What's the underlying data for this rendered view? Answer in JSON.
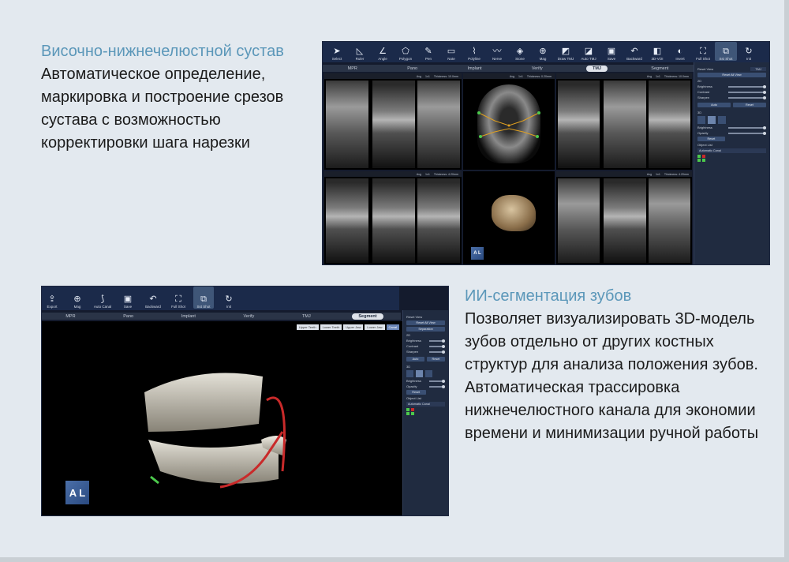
{
  "section1": {
    "title": "Височно-нижнечелюстной сустав",
    "description": "Автоматическое определение, маркировка и построение срезов сустава с возможностью корректировки шага нарезки",
    "toolbar": [
      {
        "label": "Select",
        "icon": "cursor-icon"
      },
      {
        "label": "Ruler",
        "icon": "ruler-icon"
      },
      {
        "label": "Angle",
        "icon": "angle-icon"
      },
      {
        "label": "Polygon",
        "icon": "polygon-icon"
      },
      {
        "label": "Pen",
        "icon": "pen-icon"
      },
      {
        "label": "Note",
        "icon": "note-icon"
      },
      {
        "label": "Polyline",
        "icon": "polyline-icon"
      },
      {
        "label": "Nerve",
        "icon": "nerve-icon"
      },
      {
        "label": "Stone",
        "icon": "stone-icon"
      },
      {
        "label": "Mag",
        "icon": "magnifier-icon"
      },
      {
        "label": "Draw TMJ",
        "icon": "draw-tmj-icon"
      },
      {
        "label": "Auto TMJ",
        "icon": "auto-tmj-icon"
      },
      {
        "label": "Save",
        "icon": "save-icon"
      },
      {
        "label": "Backward",
        "icon": "backward-icon"
      },
      {
        "label": "3D-VOI",
        "icon": "voi-icon"
      },
      {
        "label": "Invert",
        "icon": "invert-icon"
      },
      {
        "label": "Full Shot",
        "icon": "full-shot-icon"
      },
      {
        "label": "Sst Shot",
        "icon": "shot-icon"
      },
      {
        "label": "Init",
        "icon": "init-icon"
      }
    ],
    "tabs": [
      "MPR",
      "Pano",
      "Implant",
      "Verify",
      "TMJ",
      "Segment"
    ],
    "active_tab": "TMJ",
    "view_strip": {
      "mode": "Avg",
      "scale": "1x1",
      "thickness_a": "Thickness: 10.0mm",
      "thickness_b": "Thickness: 0.20mm",
      "thickness_c": "Thickness: 4.20mm"
    },
    "panel": {
      "reset_label": "Reset View",
      "reset_value": "TMJ",
      "reset_all": "Reset All View",
      "section_2d": "2D",
      "brightness": "Brightness",
      "contrast": "Contrast",
      "sharpen": "Sharpen",
      "auto": "Auto",
      "reset": "Reset",
      "section_3d": "3D",
      "opacity": "Opacity",
      "object_list": "Object List",
      "object_item": "Automatic Canal"
    },
    "cube_letters": "A L"
  },
  "section2": {
    "title": "ИИ-сегментация зубов",
    "description": "Позволяет визуализировать 3D-модель зубов отдельно от других костных структур для анализа положения зубов. Автоматическая трассировка нижнечелюстного канала для экономии времени и минимизации ручной работы",
    "toolbar": [
      {
        "label": "Export",
        "icon": "export-icon"
      },
      {
        "label": "Mag",
        "icon": "magnifier-icon"
      },
      {
        "label": "Auto Canal",
        "icon": "auto-canal-icon"
      },
      {
        "label": "Save",
        "icon": "save-icon"
      },
      {
        "label": "Backward",
        "icon": "backward-icon"
      },
      {
        "label": "Full Shot",
        "icon": "full-shot-icon"
      },
      {
        "label": "Sst Shot",
        "icon": "shot-icon"
      },
      {
        "label": "Init",
        "icon": "init-icon"
      }
    ],
    "tabs": [
      "MPR",
      "Pano",
      "Implant",
      "Verify",
      "TMJ",
      "Segment"
    ],
    "active_tab": "Segment",
    "layer_buttons": [
      "Upper Teeth",
      "Lower Teeth",
      "Upper Jaw",
      "Lower Jaw",
      "Canal"
    ],
    "panel": {
      "reset_label": "Reset View",
      "reset_all": "Reset All View",
      "separation": "Separation",
      "section_2d": "2D",
      "brightness": "Brightness",
      "contrast": "Contrast",
      "sharpen": "Sharpen",
      "auto": "Auto",
      "reset": "Reset",
      "section_3d": "3D",
      "opacity": "Opacity",
      "object_list": "Object List",
      "object_item": "Automatic Canal"
    },
    "cube_letters": "A L"
  },
  "colors": {
    "accent": "#5b97b9",
    "toolbar": "#1b2a4a",
    "canal": "#c92a2a",
    "marker": "#4cc94c"
  }
}
